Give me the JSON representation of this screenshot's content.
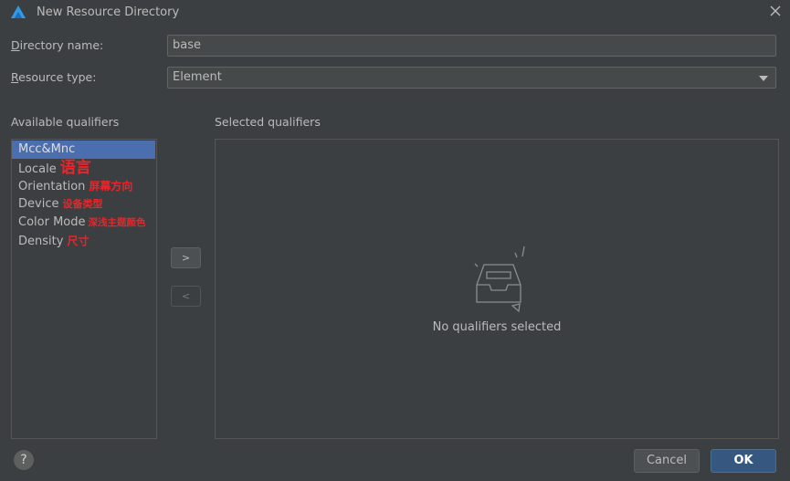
{
  "dialog": {
    "title": "New Resource Directory",
    "app_icon": "deveco-logo-icon",
    "close_icon": "close-icon"
  },
  "form": {
    "directory_name": {
      "label_mnemonic": "D",
      "label_rest": "irectory name:",
      "value": "base"
    },
    "resource_type": {
      "label_mnemonic": "R",
      "label_rest": "esource type:",
      "value": "Element"
    }
  },
  "available": {
    "label": "Available qualifiers",
    "items": [
      {
        "label": "Mcc&Mnc",
        "annotation": "",
        "selected": true
      },
      {
        "label": "Locale",
        "annotation": "语言",
        "selected": false
      },
      {
        "label": "Orientation",
        "annotation": "屏幕方向",
        "selected": false
      },
      {
        "label": "Device",
        "annotation": "设备类型",
        "selected": false
      },
      {
        "label": "Color Mode",
        "annotation": "深浅主题颜色",
        "selected": false
      },
      {
        "label": "Density",
        "annotation": "尺寸",
        "selected": false
      }
    ]
  },
  "move": {
    "add_label": ">",
    "remove_label": "<"
  },
  "selected": {
    "label": "Selected qualifiers",
    "empty_icon": "empty-inbox-icon",
    "empty_text": "No qualifiers selected"
  },
  "footer": {
    "help_label": "?",
    "cancel_label": "Cancel",
    "ok_label": "OK"
  },
  "colors": {
    "background": "#3c3f41",
    "selection": "#4b6eaf",
    "annotation": "#e8262b",
    "primary_button": "#365880"
  }
}
